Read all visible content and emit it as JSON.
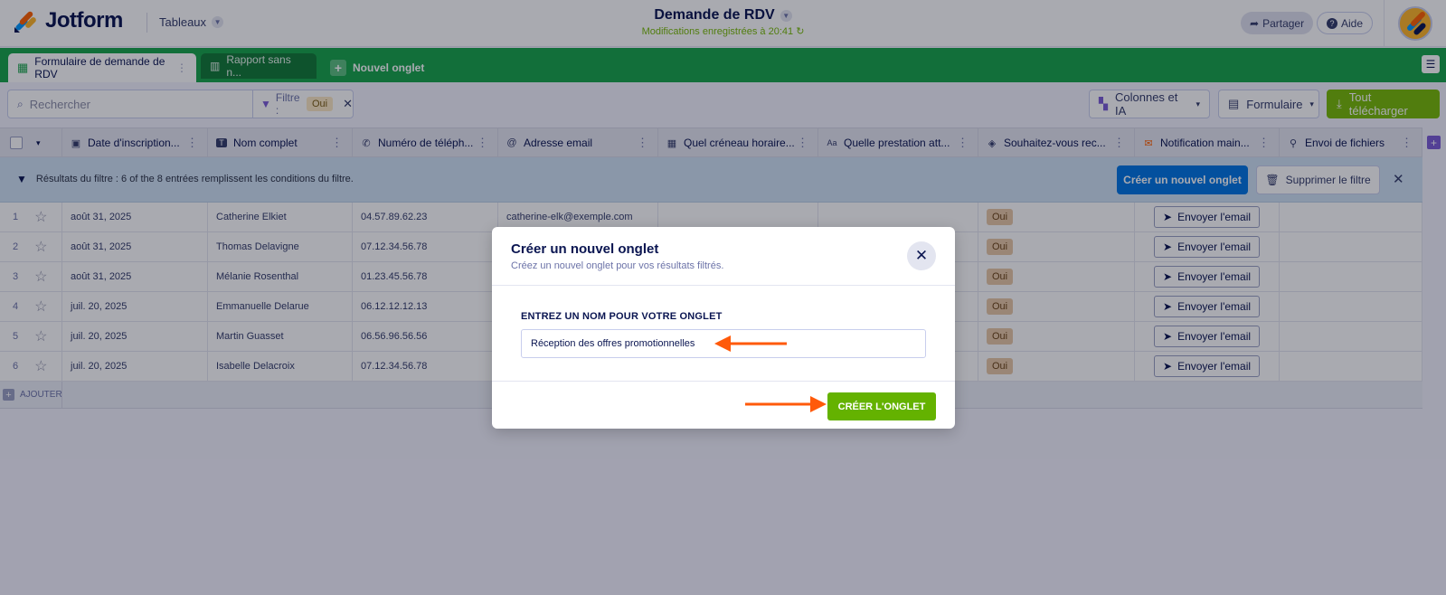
{
  "header": {
    "logo_text": "Jotform",
    "tables_label": "Tableaux",
    "doc_title": "Demande de RDV",
    "saved_status": "Modifications enregistrées à 20:41",
    "share_label": "Partager",
    "help_label": "Aide"
  },
  "tabs": {
    "active": "Formulaire de demande de RDV",
    "second": "Rapport sans n...",
    "new_tab": "Nouvel onglet"
  },
  "toolbar": {
    "search_placeholder": "Rechercher",
    "filter_label": "Filtre :",
    "filter_value": "Oui",
    "columns_label": "Colonnes et IA",
    "form_label": "Formulaire",
    "download_label": "Tout télécharger"
  },
  "columns": [
    "Date d'inscription...",
    "Nom complet",
    "Numéro de téléph...",
    "Adresse email",
    "Quel créneau horaire...",
    "Quelle prestation att...",
    "Souhaitez-vous rec...",
    "Notification main...",
    "Envoi de fichiers"
  ],
  "filter_bar": {
    "text": "Résultats du filtre : 6 of the 8 entrées remplissent les conditions du filtre.",
    "create_tab_label": "Créer un nouvel onglet",
    "delete_filter_label": "Supprimer le filtre"
  },
  "rows": [
    {
      "num": "1",
      "date": "août 31, 2025",
      "name": "Catherine Elkiet",
      "phone": "04.57.89.62.23",
      "email": "catherine-elk@exemple.com",
      "promo": "Oui",
      "action": "Envoyer l'email"
    },
    {
      "num": "2",
      "date": "août 31, 2025",
      "name": "Thomas Delavigne",
      "phone": "07.12.34.56.78",
      "email": "",
      "promo": "Oui",
      "action": "Envoyer l'email"
    },
    {
      "num": "3",
      "date": "août 31, 2025",
      "name": "Mélanie Rosenthal",
      "phone": "01.23.45.56.78",
      "email": "",
      "promo": "Oui",
      "action": "Envoyer l'email"
    },
    {
      "num": "4",
      "date": "juil. 20, 2025",
      "name": "Emmanuelle Delarue",
      "phone": "06.12.12.12.13",
      "email": "",
      "promo": "Oui",
      "action": "Envoyer l'email"
    },
    {
      "num": "5",
      "date": "juil. 20, 2025",
      "name": "Martin Guasset",
      "phone": "06.56.96.56.56",
      "email": "",
      "promo": "Oui",
      "action": "Envoyer l'email"
    },
    {
      "num": "6",
      "date": "juil. 20, 2025",
      "name": "Isabelle Delacroix",
      "phone": "07.12.34.56.78",
      "email": "",
      "promo": "Oui",
      "action": "Envoyer l'email"
    }
  ],
  "add_row_label": "AJOUTER",
  "modal": {
    "title": "Créer un nouvel onglet",
    "subtitle": "Créez un nouvel onglet pour vos résultats filtrés.",
    "field_label": "ENTREZ UN NOM POUR VOTRE ONGLET",
    "field_value": "Réception des offres promotionnelles",
    "submit_label": "CRÉER L'ONGLET"
  },
  "colors": {
    "tab_bar": "#18a54a",
    "accent_blue": "#0075e3",
    "submit_green": "#64b200",
    "annotation_arrow": "#ff5a0a"
  }
}
